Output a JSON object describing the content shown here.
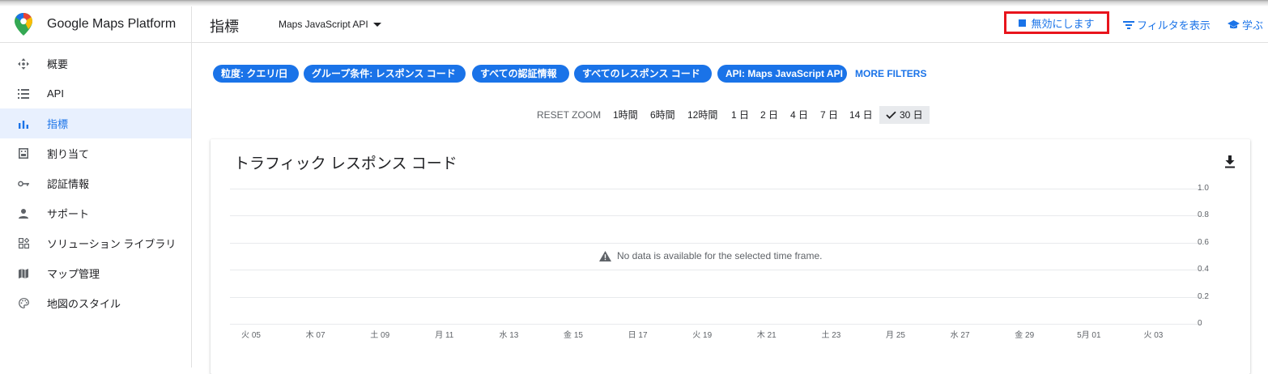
{
  "header": {
    "brand": "Google Maps Platform",
    "page_title": "指標",
    "api_selector": "Maps JavaScript API",
    "disable_label": "無効にします",
    "filter_label": "フィルタを表示",
    "learn_label": "学ぶ"
  },
  "sidebar": {
    "items": [
      {
        "label": "概要",
        "icon": "overview-icon"
      },
      {
        "label": "API",
        "icon": "list-icon"
      },
      {
        "label": "指標",
        "icon": "bar-chart-icon",
        "active": true
      },
      {
        "label": "割り当て",
        "icon": "quota-icon"
      },
      {
        "label": "認証情報",
        "icon": "key-icon"
      },
      {
        "label": "サポート",
        "icon": "person-icon"
      },
      {
        "label": "ソリューション ライブラリ",
        "icon": "library-icon"
      },
      {
        "label": "マップ管理",
        "icon": "map-icon"
      },
      {
        "label": "地図のスタイル",
        "icon": "palette-icon"
      }
    ]
  },
  "filters": {
    "chips": [
      "粒度: クエリ/日",
      "グループ条件: レスポンス コード",
      "すべての認証情報",
      "すべてのレスポンス コード",
      "API: Maps JavaScript API"
    ],
    "more": "MORE FILTERS"
  },
  "zoom": {
    "reset": "RESET ZOOM",
    "options": [
      "1時間",
      "6時間",
      "12時間",
      "1 日",
      "2 日",
      "4 日",
      "7 日",
      "14 日",
      "30 日"
    ],
    "selected": "30 日"
  },
  "chart_card": {
    "title": "トラフィック レスポンス コード",
    "no_data": "No data is available for the selected time frame."
  },
  "chart_data": {
    "type": "line",
    "title": "トラフィック レスポンス コード",
    "x_tick_labels": [
      "火 05",
      "木 07",
      "土 09",
      "月 11",
      "水 13",
      "金 15",
      "日 17",
      "火 19",
      "木 21",
      "土 23",
      "月 25",
      "水 27",
      "金 29",
      "5月 01",
      "火 03"
    ],
    "y_tick_labels": [
      "1.0",
      "0.8",
      "0.6",
      "0.4",
      "0.2",
      "0"
    ],
    "ylim": [
      0,
      1.0
    ],
    "series": [],
    "grid": true
  },
  "colors": {
    "accent": "#1a73e8",
    "highlight_border": "#e8141c"
  }
}
